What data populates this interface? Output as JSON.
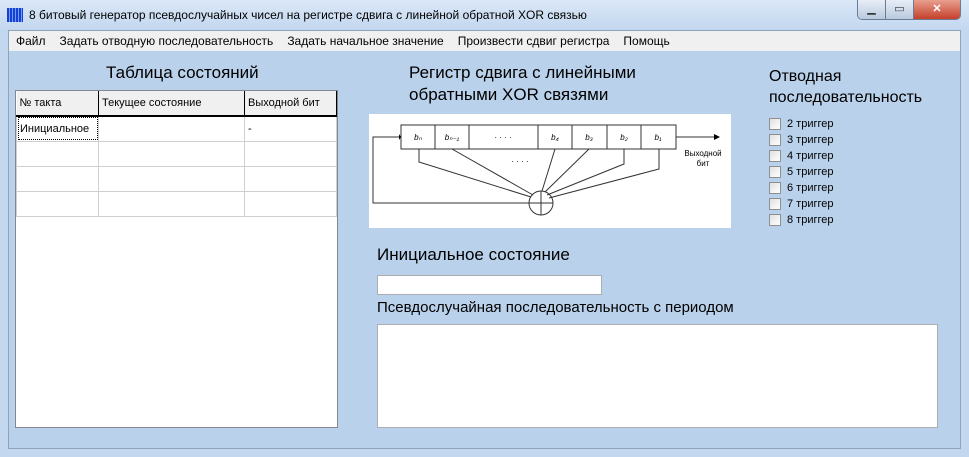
{
  "window": {
    "title": "8 битовый генератор псевдослучайных чисел на регистре сдвига с линейной обратной XOR связью"
  },
  "menu": [
    "Файл",
    "Задать отводную последовательность",
    "Задать начальное значение",
    "Произвести сдвиг регистра",
    "Помощь"
  ],
  "table": {
    "title": "Таблица состояний",
    "headers": [
      "№ такта",
      "Текущее состояние",
      "Выходной бит"
    ],
    "rows": [
      [
        "Инициальное",
        "",
        "-"
      ],
      [
        "",
        "",
        ""
      ],
      [
        "",
        "",
        ""
      ],
      [
        "",
        "",
        ""
      ]
    ]
  },
  "diagram": {
    "title_line1": "Регистр сдвига с линейными",
    "title_line2": "обратными XOR связями",
    "cells": [
      "bₙ",
      "bₙ₋₁",
      "· · · ·",
      "b₄",
      "b₃",
      "b₂",
      "b₁"
    ],
    "dots": "· · · ·",
    "output_label_1": "Выходной",
    "output_label_2": "бит"
  },
  "taps": {
    "title_line1": "Отводная",
    "title_line2": "последовательность",
    "items": [
      "2 триггер",
      "3 триггер",
      "4 триггер",
      "5 триггер",
      "6 триггер",
      "7 триггер",
      "8 триггер"
    ]
  },
  "initial": {
    "label": "Инициальное состояние",
    "value": ""
  },
  "sequence": {
    "label": "Псевдослучайная последовательность с периодом",
    "value": ""
  }
}
